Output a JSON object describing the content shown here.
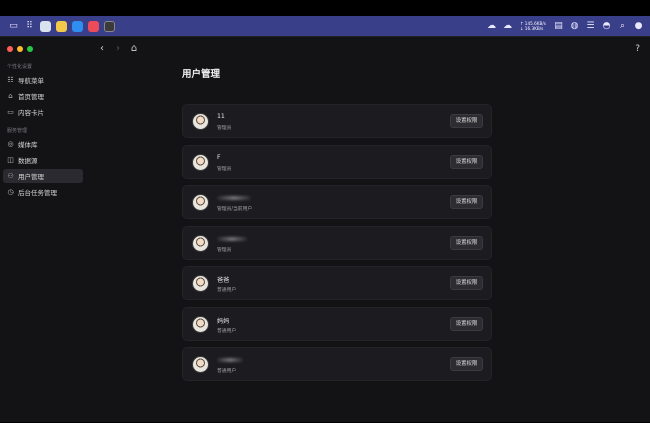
{
  "topbar": {
    "net_up": "↑ 145.6KB/s",
    "net_down": "↓ 16.3KB/s"
  },
  "window": {
    "help": "?"
  },
  "sidebar": {
    "groups": [
      {
        "title": "个性化设置",
        "items": [
          {
            "label": "导航菜单",
            "icon": "list-icon"
          },
          {
            "label": "首页管理",
            "icon": "home-icon"
          },
          {
            "label": "内容卡片",
            "icon": "card-icon"
          }
        ]
      },
      {
        "title": "服务管理",
        "items": [
          {
            "label": "媒体库",
            "icon": "media-icon"
          },
          {
            "label": "数据源",
            "icon": "database-icon"
          },
          {
            "label": "用户管理",
            "icon": "users-icon",
            "active": true
          },
          {
            "label": "后台任务管理",
            "icon": "clock-icon"
          }
        ]
      }
    ]
  },
  "main": {
    "title": "用户管理",
    "perm_button": "设置权限",
    "users": [
      {
        "name": "11",
        "role": "管理员"
      },
      {
        "name": "F",
        "role": "管理员"
      },
      {
        "name": "",
        "role": "管理员/当前用户"
      },
      {
        "name": "",
        "role": "管理员"
      },
      {
        "name": "爸爸",
        "role": "普通用户"
      },
      {
        "name": "妈妈",
        "role": "普通用户"
      },
      {
        "name": "",
        "role": "普通用户"
      }
    ]
  }
}
